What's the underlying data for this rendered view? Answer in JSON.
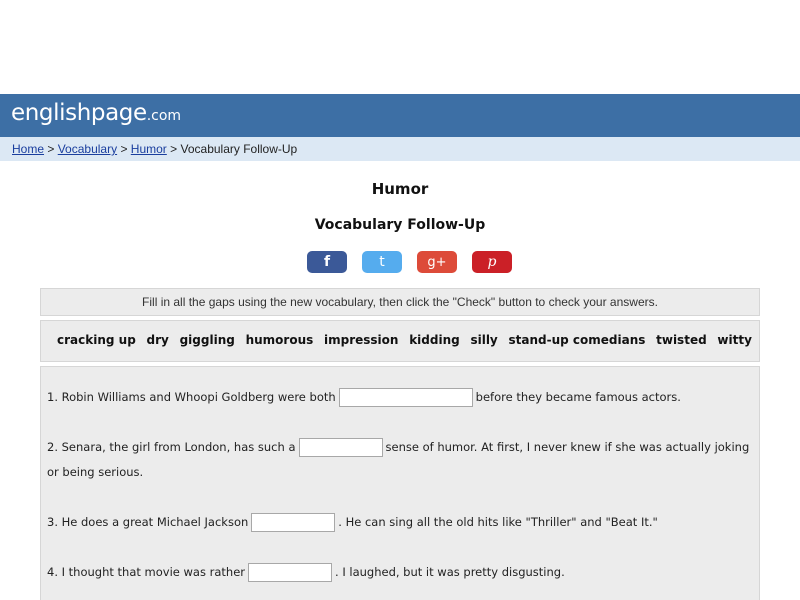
{
  "header": {
    "logo_main": "englishpage",
    "logo_suffix": ".com"
  },
  "breadcrumb": {
    "items": [
      "Home",
      "Vocabulary",
      "Humor"
    ],
    "separator": ">",
    "current": "Vocabulary Follow-Up"
  },
  "page": {
    "title": "Humor",
    "subtitle": "Vocabulary Follow-Up"
  },
  "share": {
    "facebook": "f",
    "twitter": "t",
    "googleplus": "g+",
    "pinterest": "p"
  },
  "instructions": "Fill in all the gaps using the new vocabulary, then click the \"Check\" button to check your answers.",
  "word_bank": [
    "cracking up",
    "dry",
    "giggling",
    "humorous",
    "impression",
    "kidding",
    "silly",
    "stand-up comedians",
    "twisted",
    "witty"
  ],
  "questions": [
    {
      "before": "1. Robin Williams and Whoopi Goldberg were both",
      "after": "before they became famous actors.",
      "value": ""
    },
    {
      "before": "2. Senara, the girl from London, has such a",
      "after": "sense of humor. At first, I never knew if she was actually joking or being serious.",
      "value": ""
    },
    {
      "before": "3. He does a great Michael Jackson",
      "after": ". He can sing all the old hits like \"Thriller\" and \"Beat It.\"",
      "value": ""
    },
    {
      "before": "4. I thought that movie was rather",
      "after": ". I laughed, but it was pretty disgusting.",
      "value": ""
    }
  ],
  "colors": {
    "header": "#3d6fa5",
    "breadcrumb_bg": "#dce8f4",
    "panel_bg": "#ececec",
    "facebook": "#3b5998",
    "twitter": "#55acee",
    "googleplus": "#dd4b39",
    "pinterest": "#cb2027"
  }
}
